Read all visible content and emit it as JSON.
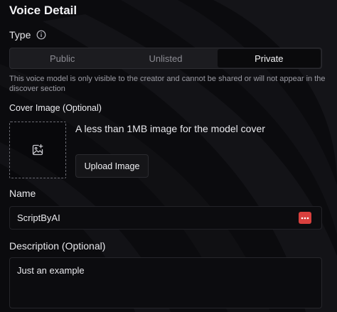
{
  "header": {
    "title": "Voice Detail"
  },
  "type_section": {
    "label": "Type",
    "info_icon": "info-circle-icon",
    "options": [
      {
        "label": "Public",
        "selected": false
      },
      {
        "label": "Unlisted",
        "selected": false
      },
      {
        "label": "Private",
        "selected": true
      }
    ],
    "note": "This voice model is only visible to the creator and cannot be shared or will not appear in the discover section"
  },
  "cover_image": {
    "label": "Cover Image (Optional)",
    "icon": "image-add-icon",
    "hint": "A less than 1MB image for the model cover",
    "upload_label": "Upload Image"
  },
  "name_field": {
    "label": "Name",
    "value": "ScriptByAI",
    "badge_icon": "more-dots-icon",
    "badge_color": "#d9403e"
  },
  "description_field": {
    "label": "Description (Optional)",
    "value": "Just an example"
  },
  "colors": {
    "background": "#0b0b0e",
    "selected_segment": "#0a0a0c",
    "segment_track": "#1c1c20"
  }
}
